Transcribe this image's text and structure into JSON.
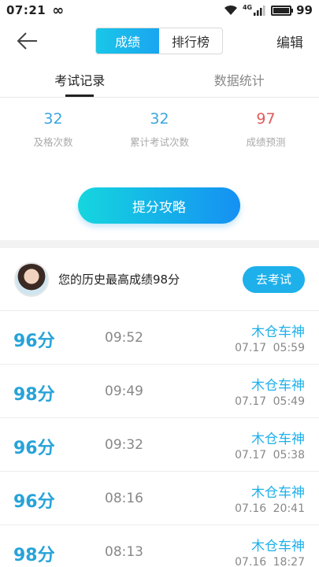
{
  "status": {
    "time": "07:21",
    "infinity": "∞",
    "signal": "4G",
    "battery_level": 0.99,
    "battery_text": "99"
  },
  "nav": {
    "segments": [
      "成绩",
      "排行榜"
    ],
    "active_segment": 0,
    "edit": "编辑"
  },
  "tabs": [
    "考试记录",
    "数据统计"
  ],
  "stats": [
    {
      "value": "32",
      "label": "及格次数",
      "color": "#3aa6e0"
    },
    {
      "value": "32",
      "label": "累计考试次数",
      "color": "#3aa6e0"
    },
    {
      "value": "97",
      "label": "成绩预测",
      "color": "#e05b5b"
    }
  ],
  "cta": "提分攻略",
  "best": {
    "text": "您的历史最高成绩98分",
    "button": "去考试"
  },
  "records": [
    {
      "score": "96分",
      "duration": "09:52",
      "user": "木仓车神",
      "date": "07.17 05:59"
    },
    {
      "score": "98分",
      "duration": "09:49",
      "user": "木仓车神",
      "date": "07.17 05:49"
    },
    {
      "score": "96分",
      "duration": "09:32",
      "user": "木仓车神",
      "date": "07.17 05:38"
    },
    {
      "score": "96分",
      "duration": "08:16",
      "user": "木仓车神",
      "date": "07.16 20:41"
    },
    {
      "score": "98分",
      "duration": "08:13",
      "user": "木仓车神",
      "date": "07.16 18:27"
    }
  ]
}
